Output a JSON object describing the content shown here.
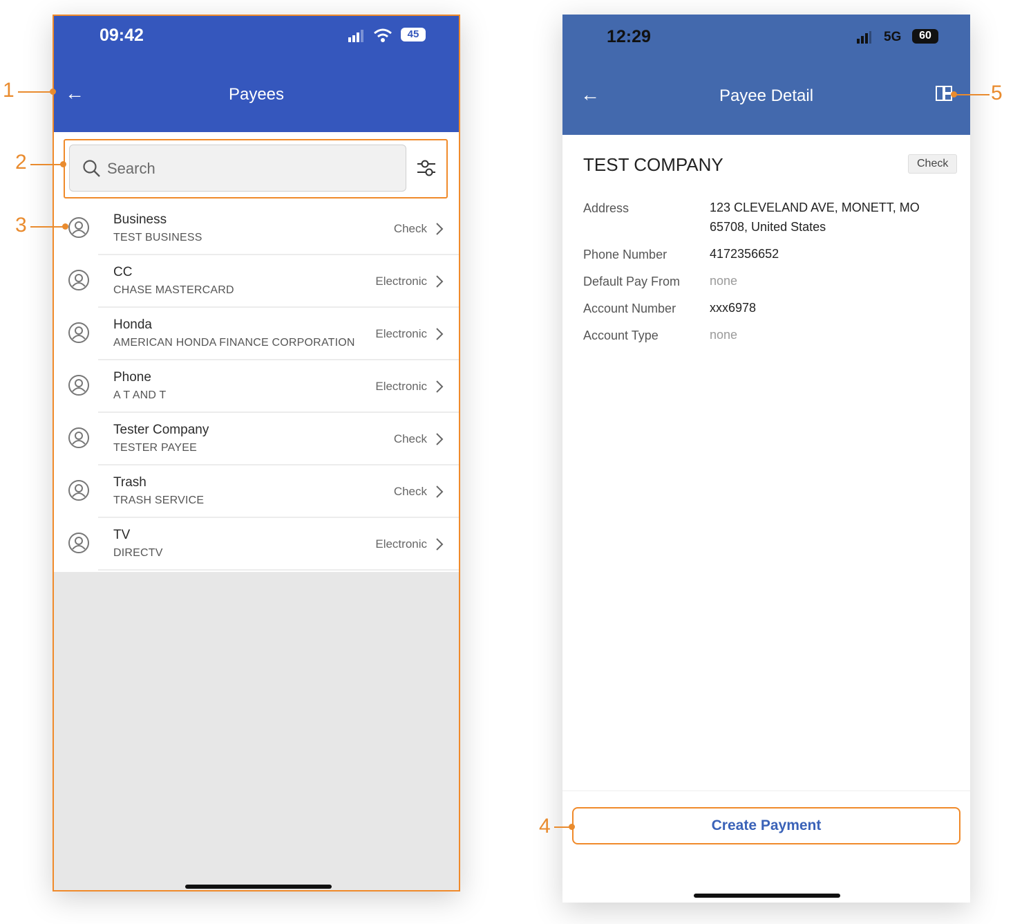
{
  "payees_screen": {
    "status_time": "09:42",
    "battery": "45",
    "title": "Payees",
    "search_placeholder": "Search",
    "payees": [
      {
        "name": "Business",
        "sub": "TEST BUSINESS",
        "type": "Check"
      },
      {
        "name": "CC",
        "sub": "CHASE MASTERCARD",
        "type": "Electronic"
      },
      {
        "name": "Honda",
        "sub": "AMERICAN HONDA FINANCE CORPORATION",
        "type": "Electronic"
      },
      {
        "name": "Phone",
        "sub": "A T AND T",
        "type": "Electronic"
      },
      {
        "name": "Tester Company",
        "sub": "TESTER PAYEE",
        "type": "Check"
      },
      {
        "name": "Trash",
        "sub": "TRASH SERVICE",
        "type": "Check"
      },
      {
        "name": "TV",
        "sub": "DIRECTV",
        "type": "Electronic"
      }
    ]
  },
  "detail_screen": {
    "status_time": "12:29",
    "network": "5G",
    "battery": "60",
    "title": "Payee Detail",
    "company": "TEST COMPANY",
    "badge": "Check",
    "fields": [
      {
        "label": "Address",
        "value": "123 CLEVELAND AVE, MONETT, MO 65708, United States"
      },
      {
        "label": "Phone Number",
        "value": "4172356652"
      },
      {
        "label": "Default Pay From",
        "value": "none"
      },
      {
        "label": "Account Number",
        "value": "xxx6978"
      },
      {
        "label": "Account Type",
        "value": "none"
      }
    ],
    "create_payment_label": "Create Payment"
  },
  "callouts": [
    "1",
    "2",
    "3",
    "4",
    "5"
  ],
  "colors": {
    "header_left": "#3557bd",
    "header_right": "#4369ad",
    "accent": "#e98b2e",
    "link_blue": "#3a62b8"
  }
}
